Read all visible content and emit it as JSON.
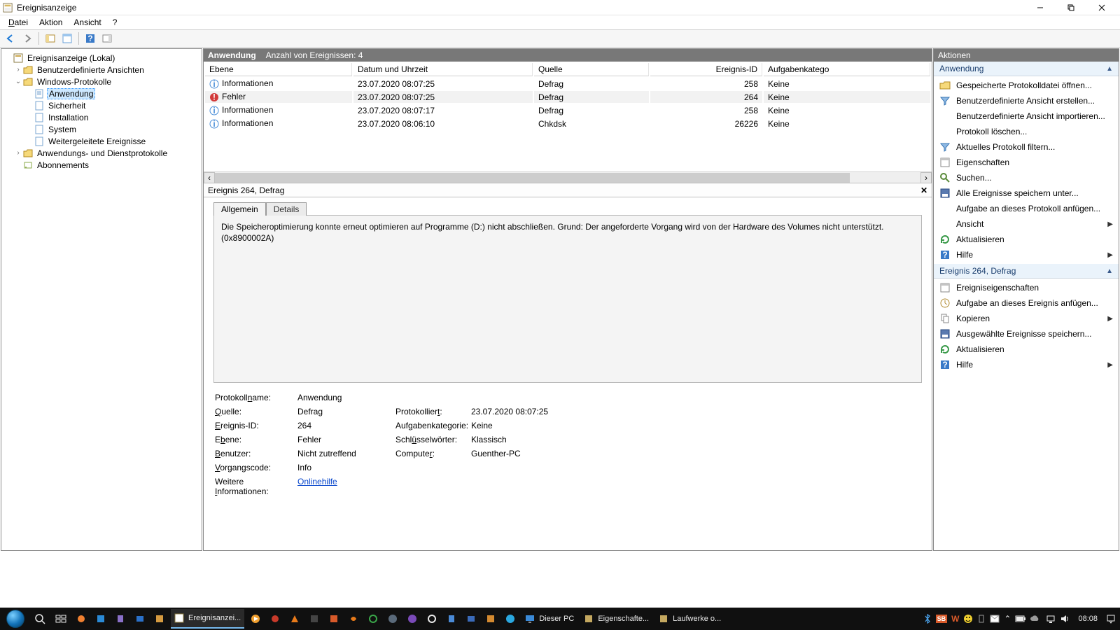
{
  "window": {
    "title": "Ereignisanzeige"
  },
  "menu": {
    "file": "Datei",
    "action": "Aktion",
    "view": "Ansicht",
    "help": "?"
  },
  "tree": {
    "root": "Ereignisanzeige (Lokal)",
    "custom_views": "Benutzerdefinierte Ansichten",
    "windows_logs": "Windows-Protokolle",
    "app": "Anwendung",
    "security": "Sicherheit",
    "setup": "Installation",
    "system": "System",
    "forwarded": "Weitergeleitete Ereignisse",
    "app_service_logs": "Anwendungs- und Dienstprotokolle",
    "subscriptions": "Abonnements"
  },
  "center": {
    "header_title": "Anwendung",
    "header_count": "Anzahl von Ereignissen: 4",
    "cols": {
      "level": "Ebene",
      "datetime": "Datum und Uhrzeit",
      "source": "Quelle",
      "event_id": "Ereignis-ID",
      "task_cat": "Aufgabenkatego"
    },
    "rows": [
      {
        "level": "Informationen",
        "kind": "info",
        "dt": "23.07.2020 08:07:25",
        "src": "Defrag",
        "id": "258",
        "cat": "Keine"
      },
      {
        "level": "Fehler",
        "kind": "error",
        "dt": "23.07.2020 08:07:25",
        "src": "Defrag",
        "id": "264",
        "cat": "Keine"
      },
      {
        "level": "Informationen",
        "kind": "info",
        "dt": "23.07.2020 08:07:17",
        "src": "Defrag",
        "id": "258",
        "cat": "Keine"
      },
      {
        "level": "Informationen",
        "kind": "info",
        "dt": "23.07.2020 08:06:10",
        "src": "Chkdsk",
        "id": "26226",
        "cat": "Keine"
      }
    ]
  },
  "detail": {
    "header": "Ereignis 264, Defrag",
    "tab_general": "Allgemein",
    "tab_details": "Details",
    "message": "Die Speicheroptimierung konnte erneut optimieren auf Programme (D:) nicht abschließen. Grund: Der angeforderte Vorgang wird von der Hardware des Volumes nicht unterstützt. (0x8900002A)",
    "labels": {
      "logname": "Protokollname:",
      "source": "Quelle:",
      "eventid": "Ereignis-ID:",
      "level": "Ebene:",
      "user": "Benutzer:",
      "opcode": "Vorgangscode:",
      "moreinfo": "Weitere Informationen:",
      "logged": "Protokolliert:",
      "taskcat": "Aufgabenkategorie:",
      "keywords": "Schlüsselwörter:",
      "computer": "Computer:"
    },
    "values": {
      "logname": "Anwendung",
      "source": "Defrag",
      "eventid": "264",
      "level": "Fehler",
      "user": "Nicht zutreffend",
      "opcode": "Info",
      "moreinfo": "Onlinehilfe",
      "logged": "23.07.2020 08:07:25",
      "taskcat": "Keine",
      "keywords": "Klassisch",
      "computer": "Guenther-PC"
    }
  },
  "actions": {
    "title": "Aktionen",
    "section1": "Anwendung",
    "section2": "Ereignis 264, Defrag",
    "items1": {
      "open_saved": "Gespeicherte Protokolldatei öffnen...",
      "create_view": "Benutzerdefinierte Ansicht erstellen...",
      "import_view": "Benutzerdefinierte Ansicht importieren...",
      "clear_log": "Protokoll löschen...",
      "filter": "Aktuelles Protokoll filtern...",
      "properties": "Eigenschaften",
      "find": "Suchen...",
      "save_all": "Alle Ereignisse speichern unter...",
      "attach_task": "Aufgabe an dieses Protokoll anfügen...",
      "view": "Ansicht",
      "refresh": "Aktualisieren",
      "help": "Hilfe"
    },
    "items2": {
      "event_props": "Ereigniseigenschaften",
      "attach_event": "Aufgabe an dieses Ereignis anfügen...",
      "copy": "Kopieren",
      "save_selected": "Ausgewählte Ereignisse speichern...",
      "refresh": "Aktualisieren",
      "help": "Hilfe"
    }
  },
  "taskbar": {
    "eventviewer": "Ereignisanzei...",
    "this_pc": "Dieser PC",
    "properties": "Eigenschafte...",
    "drives": "Laufwerke o...",
    "clock": "08:08"
  }
}
